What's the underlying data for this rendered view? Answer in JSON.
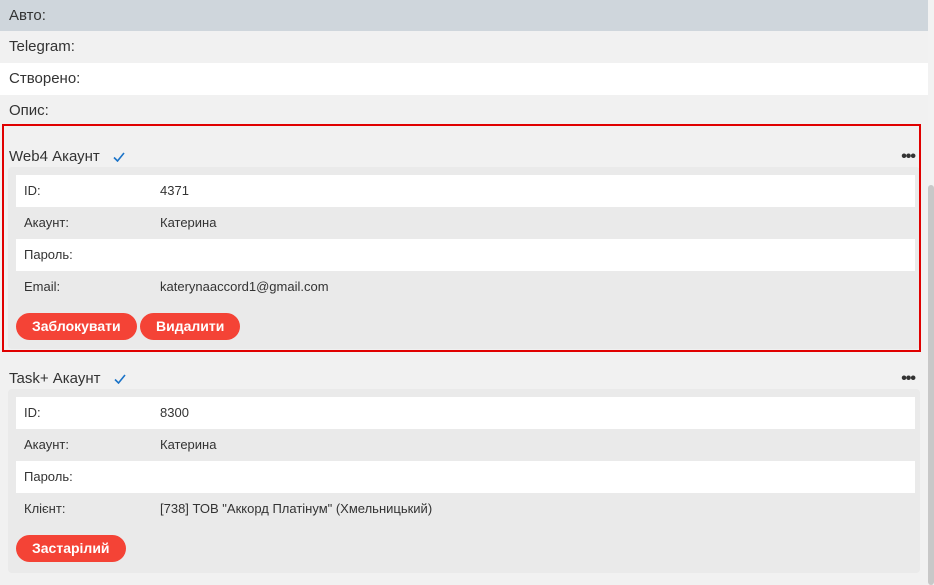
{
  "profile": {
    "rows": [
      {
        "label": "Авто:"
      },
      {
        "label": "Telegram:"
      },
      {
        "label": "Створено:"
      },
      {
        "label": "Опис:"
      }
    ]
  },
  "accounts": [
    {
      "title": "Web4 Акаунт",
      "verified_icon": "check-icon",
      "menu_label": "•••",
      "fields": [
        {
          "label": "ID:",
          "value": "4371"
        },
        {
          "label": "Акаунт:",
          "value": "Катерина"
        },
        {
          "label": "Пароль:",
          "value": ""
        },
        {
          "label": "Email:",
          "value": "katerynaaccord1@gmail.com"
        }
      ],
      "buttons": [
        {
          "label": "Заблокувати"
        },
        {
          "label": "Видалити"
        }
      ]
    },
    {
      "title": "Task+ Акаунт",
      "verified_icon": "check-icon",
      "menu_label": "•••",
      "fields": [
        {
          "label": "ID:",
          "value": "8300"
        },
        {
          "label": "Акаунт:",
          "value": "Катерина"
        },
        {
          "label": "Пароль:",
          "value": ""
        },
        {
          "label": "Клієнт:",
          "value": "[738] ТОВ \"Аккорд Платінум\" (Хмельницький)"
        }
      ],
      "buttons": [
        {
          "label": "Застарілий"
        }
      ]
    }
  ],
  "colors": {
    "accent_button": "#f44336",
    "highlight_border": "#e00000",
    "check": "#1a73c8"
  }
}
